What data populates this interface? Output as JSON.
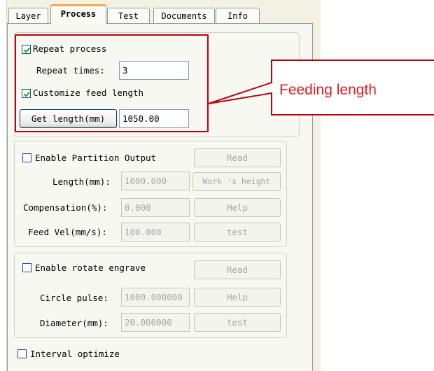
{
  "tabs": [
    {
      "label": "Layer"
    },
    {
      "label": "Process"
    },
    {
      "label": "Test"
    },
    {
      "label": "Documents"
    },
    {
      "label": "Info"
    }
  ],
  "repeat": {
    "repeat_process_label": "Repeat process",
    "repeat_process_checked": true,
    "repeat_times_label": "Repeat times:",
    "repeat_times_value": "3",
    "customize_feed_label": "Customize feed length",
    "customize_feed_checked": true,
    "get_length_button": "Get length(mm)",
    "feed_length_value": "1050.00"
  },
  "partition": {
    "enable_label": "Enable Partition Output",
    "enable_checked": false,
    "length_label": "Length(mm):",
    "length_value": "1000.000",
    "compensation_label": "Compensation(%):",
    "compensation_value": "0.000",
    "feed_vel_label": "Feed Vel(mm/s):",
    "feed_vel_value": "100.000",
    "read_button": "Read",
    "work_height_button": "Work 's height",
    "help_button": "Help",
    "test_button": "test"
  },
  "rotate": {
    "enable_label": "Enable rotate engrave",
    "enable_checked": false,
    "circle_pulse_label": "Circle pulse:",
    "circle_pulse_value": "1000.000000",
    "diameter_label": "Diameter(mm):",
    "diameter_value": "20.000000",
    "read_button": "Read",
    "help_button": "Help",
    "test_button": "test"
  },
  "interval": {
    "label": "Interval optimize",
    "checked": false
  },
  "annotation": {
    "text": "Feeding length",
    "color": "#e31b23"
  }
}
